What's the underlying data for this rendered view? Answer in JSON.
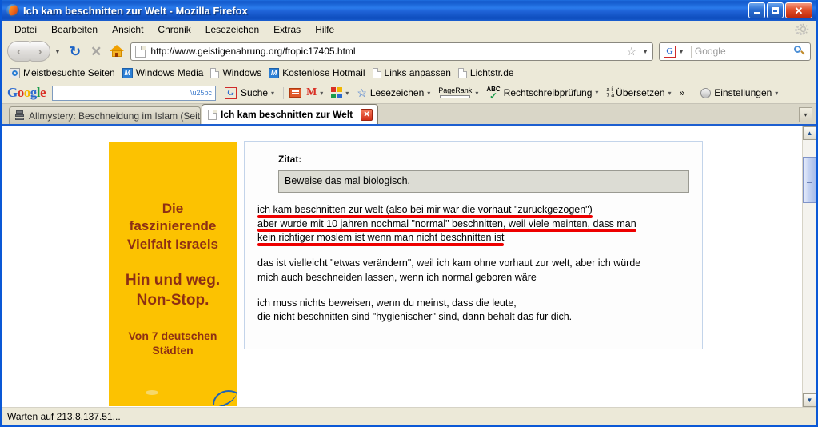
{
  "window": {
    "title": "Ich kam beschnitten zur Welt - Mozilla Firefox",
    "minimize_label": "_",
    "maximize_label": "",
    "close_label": "✕"
  },
  "menubar": {
    "items": [
      "Datei",
      "Bearbeiten",
      "Ansicht",
      "Chronik",
      "Lesezeichen",
      "Extras",
      "Hilfe"
    ]
  },
  "navbar": {
    "back_glyph": "‹",
    "forward_glyph": "›",
    "dropdown_glyph": "▼",
    "reload_glyph": "↻",
    "stop_glyph": "✕",
    "url": "http://www.geistigenahrung.org/ftopic17405.html",
    "star_glyph": "☆",
    "search_engine": "G",
    "search_placeholder": "Google"
  },
  "bookmarks": [
    {
      "label": "Meistbesuchte Seiten",
      "icon": "star-circle-icon"
    },
    {
      "label": "Windows Media",
      "icon": "media-icon"
    },
    {
      "label": "Windows",
      "icon": "page-icon"
    },
    {
      "label": "Kostenlose Hotmail",
      "icon": "media-icon"
    },
    {
      "label": "Links anpassen",
      "icon": "page-icon"
    },
    {
      "label": "Lichtstr.de",
      "icon": "page-icon"
    }
  ],
  "google_toolbar": {
    "logo": [
      "G",
      "o",
      "o",
      "g",
      "l",
      "e"
    ],
    "input_value": "",
    "suche_label": "Suche",
    "lesezeichen_label": "Lesezeichen",
    "pagerank_label": "PageRank",
    "spellcheck_label": "Rechtschreibprüfung",
    "spellcheck_badge": "ABC",
    "translate_label": "Übersetzen",
    "translate_badge_top": "a í",
    "translate_badge_bottom": "7 à",
    "more_glyph": "»",
    "settings_label": "Einstellungen",
    "caret": "▾"
  },
  "tabs": [
    {
      "label": "Allmystery: Beschneidung im Islam (Seit...",
      "active": false,
      "close": "✕"
    },
    {
      "label": "Ich kam beschnitten zur Welt",
      "active": true,
      "close": "✕"
    }
  ],
  "tab_list_glyph": "▾",
  "page": {
    "ad": {
      "line1": "Die\nfaszinierende\nVielfalt Israels",
      "line2": "Hin und weg.\nNon-Stop.",
      "line3": "Von 7 deutschen\nStädten"
    },
    "post": {
      "quote_label": "Zitat:",
      "quote_text": "Beweise das mal biologisch.",
      "highlighted_lines": [
        "ich kam beschnitten zur welt (also bei mir war die vorhaut \"zurückgezogen\")",
        "aber wurde mit 10 jahren nochmal \"normal\" beschnitten, weil viele meinten, dass man",
        "kein richtiger moslem ist wenn man nicht beschnitten ist"
      ],
      "paragraph2_line1": "das ist vielleicht \"etwas verändern\", weil ich kam ohne vorhaut zur welt, aber ich würde",
      "paragraph2_line2": "mich auch beschneiden lassen, wenn ich normal geboren wäre",
      "paragraph3_line1": "ich muss nichts beweisen, wenn du meinst, dass die leute,",
      "paragraph3_line2": "die nicht beschnitten sind \"hygienischer\" sind, dann behalt das für dich."
    }
  },
  "scrollbar": {
    "up_glyph": "▲",
    "down_glyph": "▼"
  },
  "statusbar": {
    "text": "Warten auf 213.8.137.51..."
  },
  "colors": {
    "titlebar_blue": "#1257c9",
    "ad_yellow": "#fcc201",
    "ad_text": "#8d2f14",
    "highlight_red": "#ee0000",
    "chrome_beige": "#ece9d8"
  }
}
